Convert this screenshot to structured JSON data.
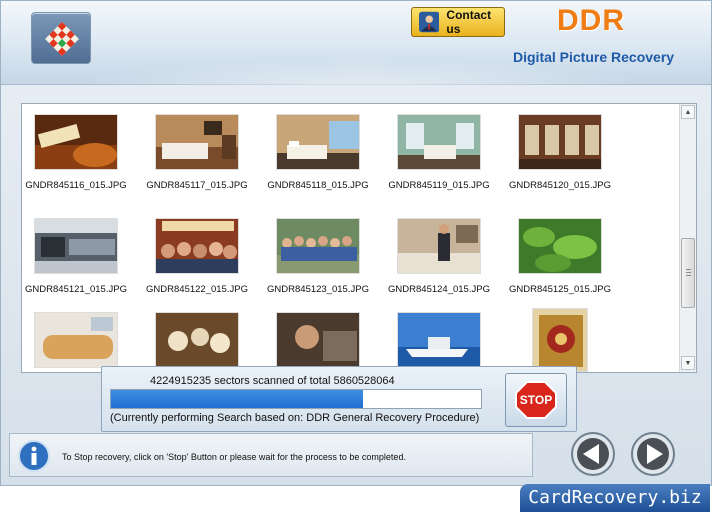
{
  "header": {
    "contact_label": "Contact us",
    "brand": "DDR",
    "subtitle": "Digital Picture Recovery"
  },
  "files": [
    {
      "name": "GNDR845116_015.JPG"
    },
    {
      "name": "GNDR845117_015.JPG"
    },
    {
      "name": "GNDR845118_015.JPG"
    },
    {
      "name": "GNDR845119_015.JPG"
    },
    {
      "name": "GNDR845120_015.JPG"
    },
    {
      "name": "GNDR845121_015.JPG"
    },
    {
      "name": "GNDR845122_015.JPG"
    },
    {
      "name": "GNDR845123_015.JPG"
    },
    {
      "name": "GNDR845124_015.JPG"
    },
    {
      "name": "GNDR845125_015.JPG"
    }
  ],
  "progress": {
    "line1": "4224915235 sectors scanned of total 5860528064",
    "fraction": 0.68,
    "line2": "(Currently performing Search based on:  DDR General Recovery Procedure)",
    "stop_label": "STOP"
  },
  "status": {
    "text": "To Stop recovery, click on 'Stop' Button or please wait for the process to be completed."
  },
  "footer": {
    "text": "CardRecovery.biz"
  },
  "colors": {
    "brand_orange": "#f07c14",
    "title_blue": "#1f5aa8",
    "progress_blue": "#1f6fd1",
    "stop_red": "#d8261c"
  }
}
